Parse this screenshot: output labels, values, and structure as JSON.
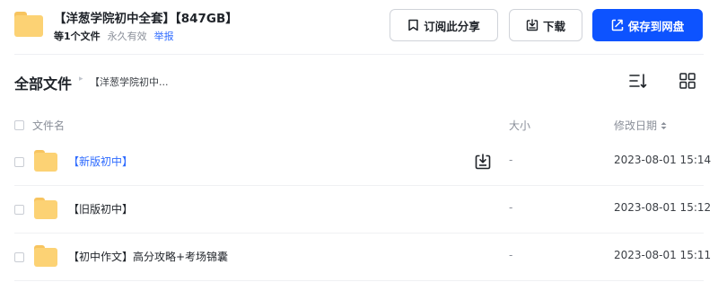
{
  "share": {
    "title": "【洋葱学院初中全套】【847GB】",
    "file_count": "等1个文件",
    "validity": "永久有效",
    "report": "举报"
  },
  "actions": {
    "subscribe": "订阅此分享",
    "download": "下载",
    "save": "保存到网盘"
  },
  "breadcrumb": {
    "root": "全部文件",
    "separator": "▸",
    "current": "【洋葱学院初中..."
  },
  "table": {
    "headers": {
      "name": "文件名",
      "size": "大小",
      "date": "修改日期"
    },
    "rows": [
      {
        "name": "【新版初中】",
        "size": "-",
        "date": "2023-08-01 15:14"
      },
      {
        "name": "【旧版初中】",
        "size": "-",
        "date": "2023-08-01 15:12"
      },
      {
        "name": "【初中作文】高分攻略+考场锦囊",
        "size": "-",
        "date": "2023-08-01 15:11"
      }
    ]
  },
  "colors": {
    "primary": "#0d53ff",
    "link": "#2e6bff",
    "folder": "#fcd274"
  }
}
